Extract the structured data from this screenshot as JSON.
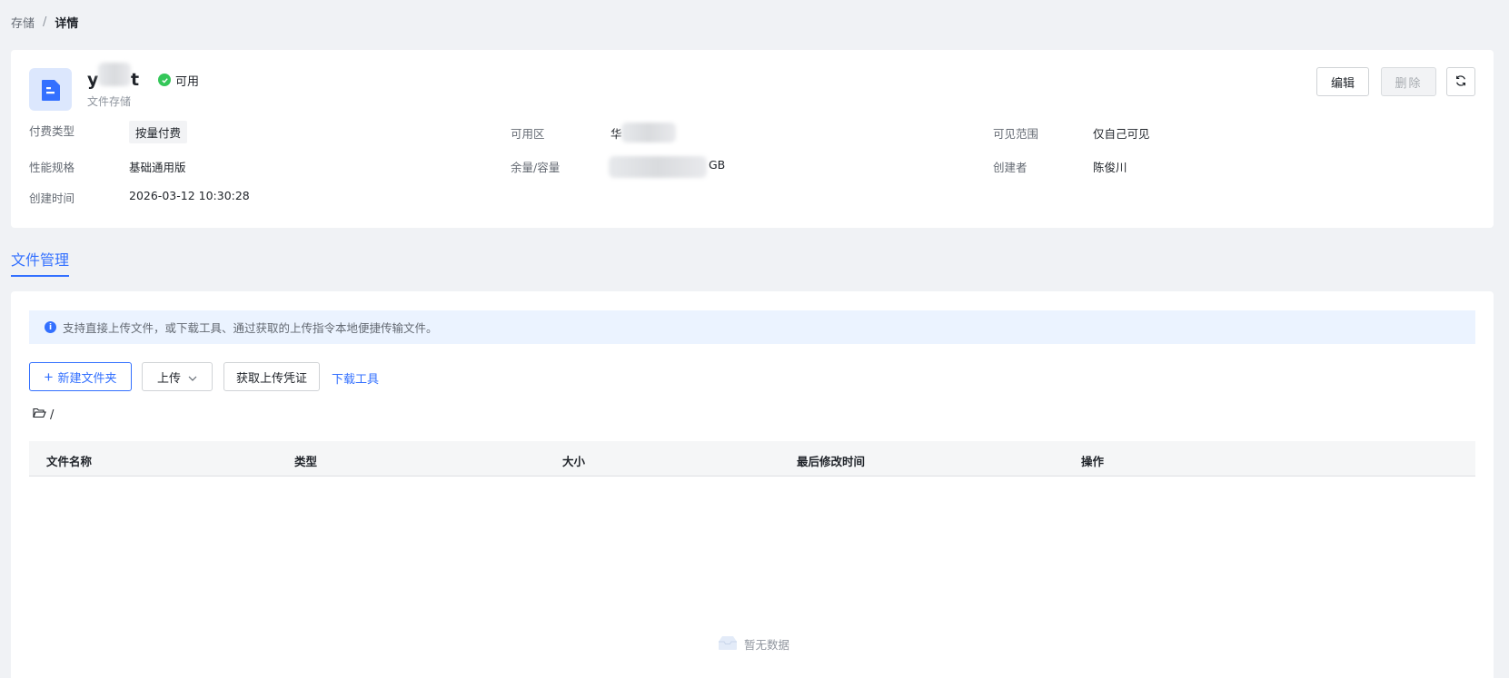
{
  "breadcrumb": {
    "parent": "存储",
    "separator": "/",
    "current": "详情"
  },
  "resource": {
    "name_visible": "y",
    "name_suffix": "t",
    "status": "可用",
    "type": "文件存储"
  },
  "header_buttons": {
    "edit": "编辑",
    "delete": "删除"
  },
  "info": {
    "billing_label": "付费类型",
    "billing_value": "按量付费",
    "zone_label": "可用区",
    "zone_value_prefix": "华",
    "visibility_label": "可见范围",
    "visibility_value": "仅自己可见",
    "spec_label": "性能规格",
    "spec_value": "基础通用版",
    "capacity_label": "余量/容量",
    "capacity_unit": "GB",
    "creator_label": "创建者",
    "creator_value": "陈俊川",
    "created_label": "创建时间",
    "created_value": "2026-03-12 10:30:28"
  },
  "tab": {
    "label": "文件管理"
  },
  "alert": {
    "text": "支持直接上传文件，或下载工具、通过获取的上传指令本地便捷传输文件。"
  },
  "toolbar": {
    "new_folder": "新建文件夹",
    "upload": "上传",
    "get_credential": "获取上传凭证",
    "download_tool": "下载工具"
  },
  "path": {
    "current": "/"
  },
  "table": {
    "columns": [
      "文件名称",
      "类型",
      "大小",
      "最后修改时间",
      "操作"
    ],
    "rows": [],
    "empty_text": "暂无数据"
  },
  "colors": {
    "primary": "#3370ff",
    "success": "#34c759",
    "background": "#f0f2f5"
  }
}
